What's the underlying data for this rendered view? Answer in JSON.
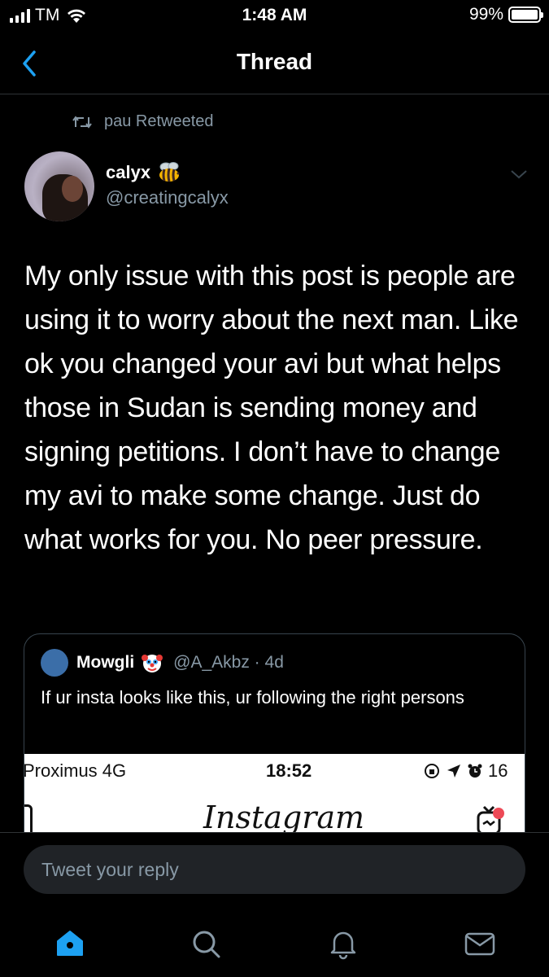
{
  "status_bar": {
    "carrier": "TM",
    "time": "1:48 AM",
    "battery": "99%",
    "battery_level": 0.99
  },
  "nav": {
    "title": "Thread",
    "back_icon": "chevron-left-icon"
  },
  "retweet_context": {
    "icon": "retweet-icon",
    "text": "pau Retweeted"
  },
  "tweet": {
    "author_name": "calyx",
    "author_emoji": "bee-icon",
    "author_handle": "@creatingcalyx",
    "text": "My only issue with this post is people are using it to worry about the next man. Like ok you changed your avi but what helps those in Sudan is sending money and signing petitions. I don’t have to change my avi to make some change. Just do what works for you. No peer pressure."
  },
  "quoted_tweet": {
    "author_name": "Mowgli",
    "author_emoji": "clown-icon",
    "meta": "@A_Akbz · 4d",
    "text": "If ur insta looks like this, ur following the right persons",
    "media": {
      "carrier": "Proximus  4G",
      "time": "18:52",
      "right": "16",
      "app_title": "Instagram"
    }
  },
  "composer": {
    "placeholder": "Tweet your reply"
  },
  "tabbar": {
    "items": [
      "home-icon",
      "search-icon",
      "notifications-bell-icon",
      "messages-envelope-icon"
    ],
    "active_color": "#1da1f2",
    "inactive_color": "#8899a6"
  }
}
